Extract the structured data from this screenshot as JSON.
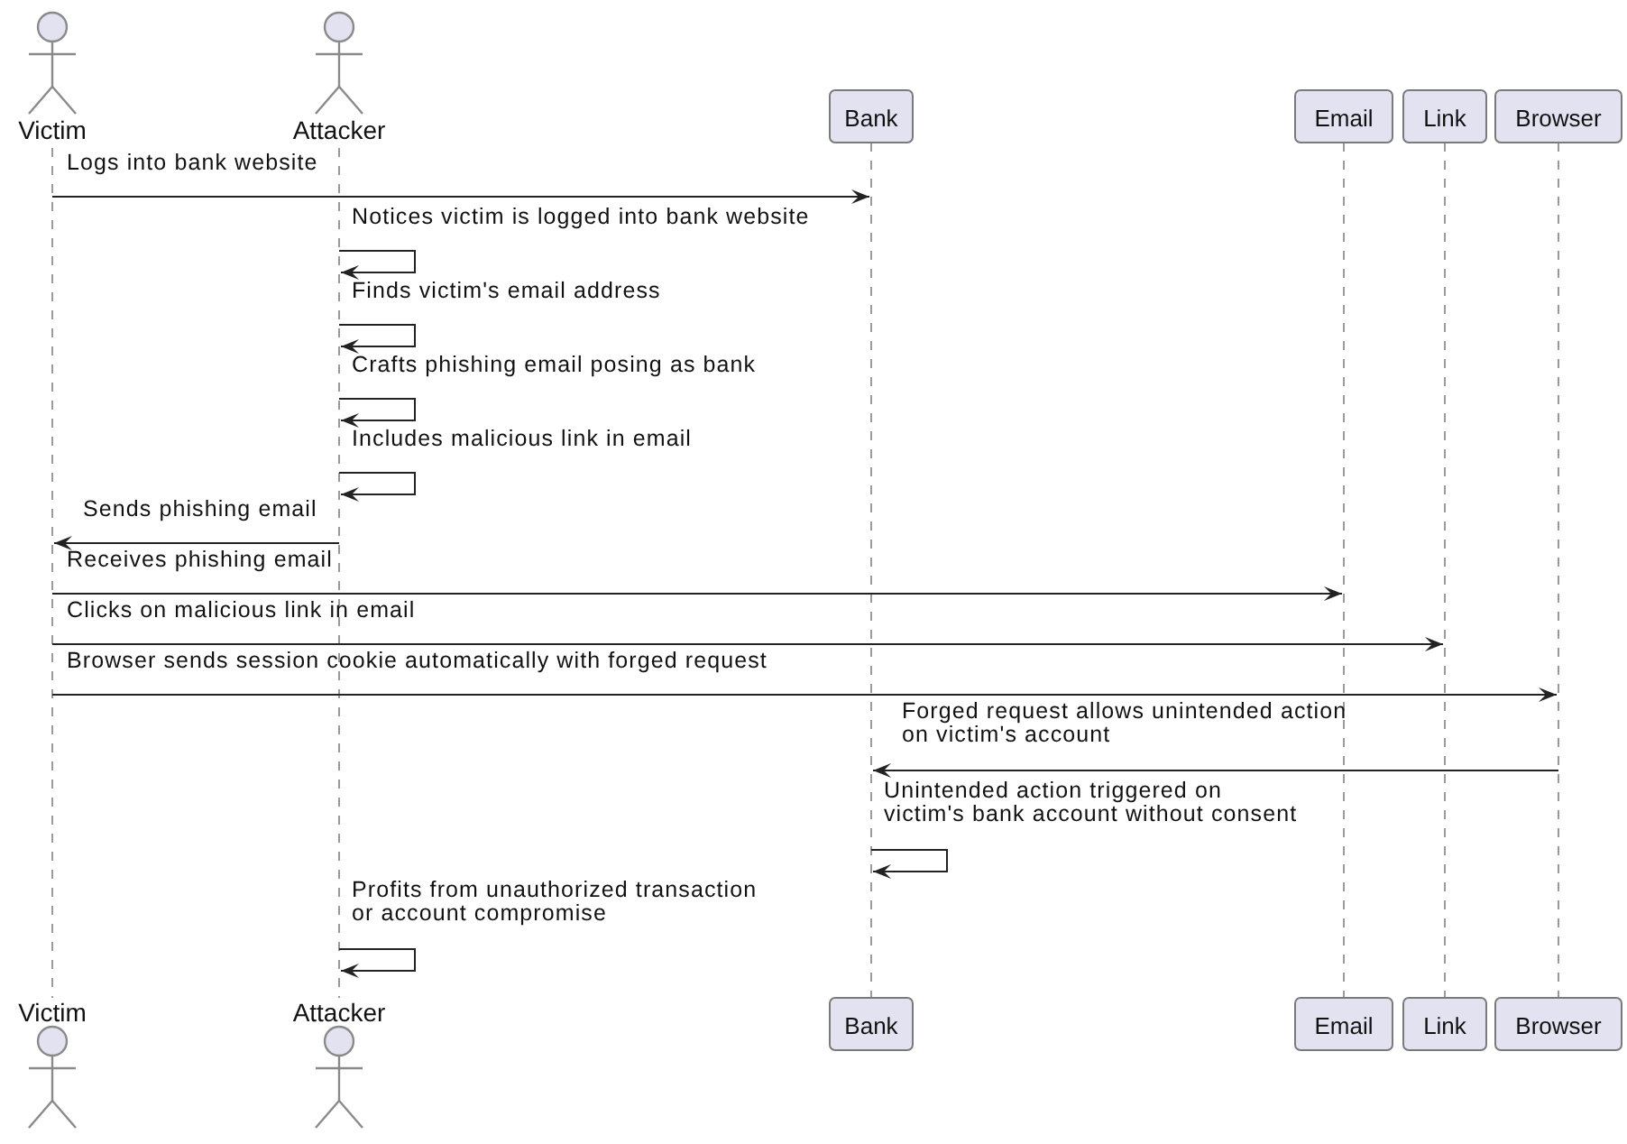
{
  "participants_top": [
    {
      "kind": "actor",
      "label": "Victim"
    },
    {
      "kind": "actor",
      "label": "Attacker"
    },
    {
      "kind": "box",
      "label": "Bank"
    },
    {
      "kind": "box",
      "label": "Email"
    },
    {
      "kind": "box",
      "label": "Link"
    },
    {
      "kind": "box",
      "label": "Browser"
    }
  ],
  "messages": [
    {
      "lines": [
        "Logs into bank website"
      ]
    },
    {
      "lines": [
        "Notices victim is logged into bank website"
      ]
    },
    {
      "lines": [
        "Finds victim's email address"
      ]
    },
    {
      "lines": [
        "Crafts phishing email posing as bank"
      ]
    },
    {
      "lines": [
        "Includes malicious link in email"
      ]
    },
    {
      "lines": [
        "Sends phishing email"
      ]
    },
    {
      "lines": [
        "Receives phishing email"
      ]
    },
    {
      "lines": [
        "Clicks on malicious link in email"
      ]
    },
    {
      "lines": [
        "Browser sends session cookie automatically with forged request"
      ]
    },
    {
      "lines": [
        "Forged request allows unintended action",
        "on victim's account"
      ]
    },
    {
      "lines": [
        "Unintended action triggered on",
        "victim's bank account without consent"
      ]
    },
    {
      "lines": [
        "Profits from unauthorized transaction",
        "or account compromise"
      ]
    }
  ],
  "participants_bottom": [
    {
      "kind": "actor",
      "label": "Victim"
    },
    {
      "kind": "actor",
      "label": "Attacker"
    },
    {
      "kind": "box",
      "label": "Bank"
    },
    {
      "kind": "box",
      "label": "Email"
    },
    {
      "kind": "box",
      "label": "Link"
    },
    {
      "kind": "box",
      "label": "Browser"
    }
  ]
}
